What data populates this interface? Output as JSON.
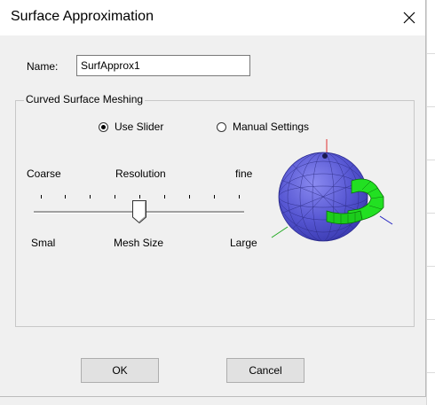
{
  "window": {
    "title": "Surface Approximation"
  },
  "name_field": {
    "label": "Name:",
    "value": "SurfApprox1"
  },
  "group": {
    "label": "Curved Surface Meshing"
  },
  "radios": {
    "use_slider": {
      "label": "Use Slider",
      "selected": true
    },
    "manual_settings": {
      "label": "Manual Settings",
      "selected": false
    }
  },
  "resolution": {
    "left_label": "Coarse",
    "center_label": "Resolution",
    "right_label": "fine"
  },
  "mesh_size": {
    "left_label": "Smal",
    "center_label": "Mesh Size",
    "right_label": "Large"
  },
  "slider": {
    "ticks": 9,
    "value_fraction": 0.5
  },
  "buttons": {
    "ok": "OK",
    "cancel": "Cancel"
  },
  "colors": {
    "sphere": "#5b5bd6",
    "ring": "#22e022",
    "axis_x": "#22aa22",
    "axis_y": "#e03030",
    "axis_z": "#2020c0"
  },
  "icons": {
    "close": "close-icon",
    "preview": "mesh-preview-icon"
  }
}
